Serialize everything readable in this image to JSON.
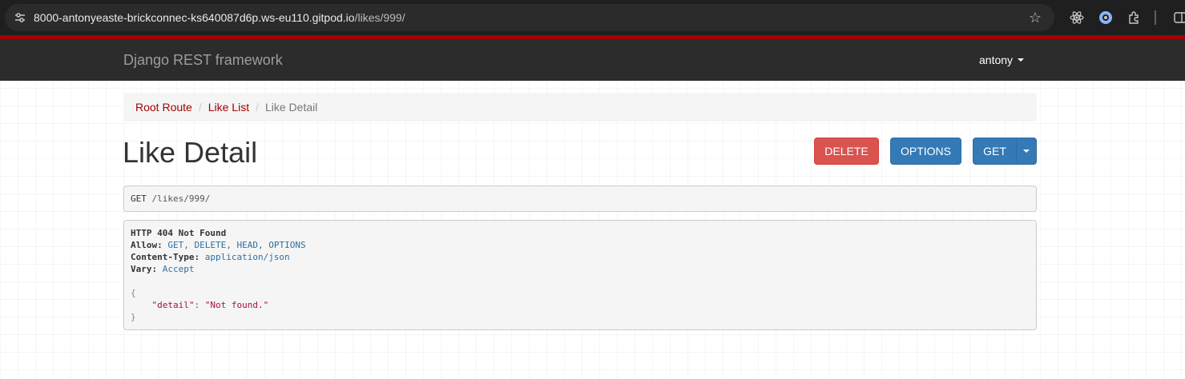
{
  "browser": {
    "url_host": "8000-antonyeaste-brickconnec-ks640087d6p.ws-eu110.gitpod.io",
    "url_path": "/likes/999/"
  },
  "navbar": {
    "brand": "Django REST framework",
    "user": "antony"
  },
  "breadcrumb": {
    "items": [
      "Root Route",
      "Like List",
      "Like Detail"
    ]
  },
  "page": {
    "title": "Like Detail"
  },
  "buttons": {
    "delete": "DELETE",
    "options": "OPTIONS",
    "get": "GET"
  },
  "request": {
    "method": "GET",
    "path": "/likes/999/"
  },
  "response": {
    "status": "HTTP 404 Not Found",
    "allow_label": "Allow:",
    "allow_value": "GET, DELETE, HEAD, OPTIONS",
    "content_type_label": "Content-Type:",
    "content_type_value": "application/json",
    "vary_label": "Vary:",
    "vary_value": "Accept",
    "json_open": "{",
    "json_key": "\"detail\"",
    "json_colon": ": ",
    "json_value": "\"Not found.\"",
    "json_close": "}"
  },
  "colors": {
    "accent_red": "#a30000",
    "danger": "#d9534f",
    "primary": "#337ab7"
  }
}
